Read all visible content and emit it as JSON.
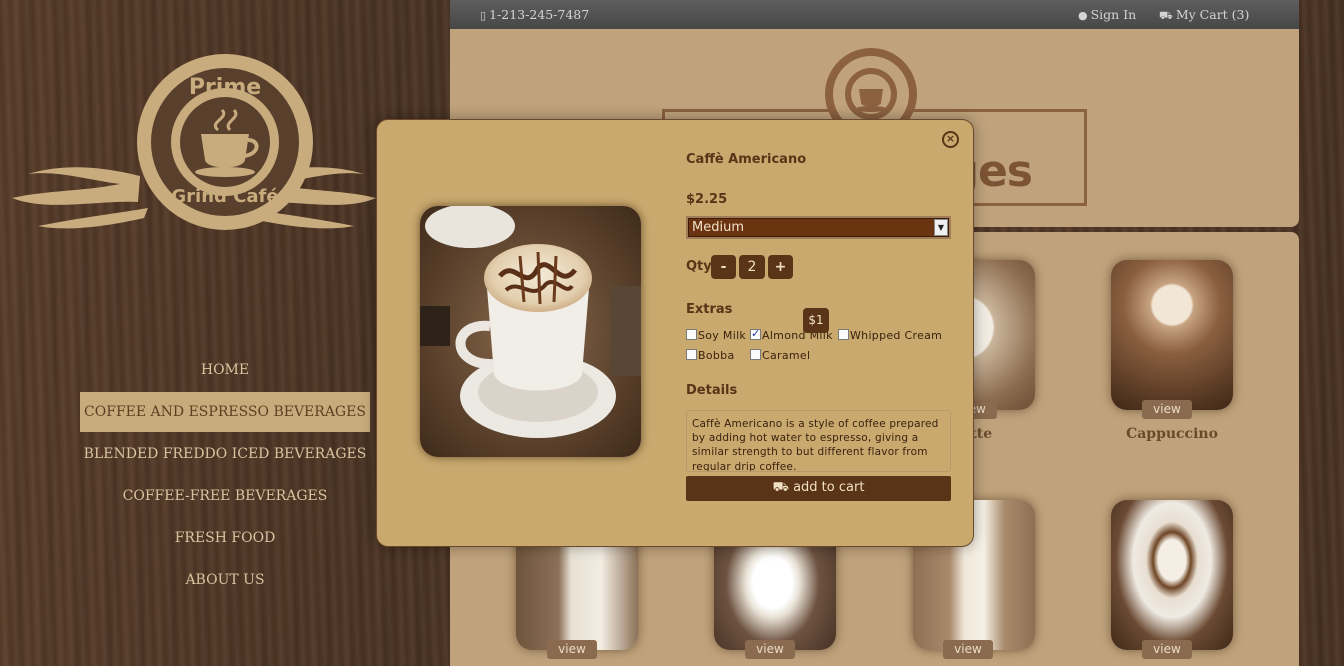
{
  "brand": {
    "logo_top": "Prime",
    "logo_bottom": "Grind Café"
  },
  "nav": {
    "items": [
      {
        "label": "HOME"
      },
      {
        "label": "COFFEE AND ESPRESSO BEVERAGES"
      },
      {
        "label": "BLENDED FREDDO ICED BEVERAGES"
      },
      {
        "label": "COFFEE-FREE BEVERAGES"
      },
      {
        "label": "FRESH FOOD"
      },
      {
        "label": "ABOUT US"
      }
    ],
    "active_index": 1
  },
  "topbar": {
    "phone": "1-213-245-7487",
    "sign_in": "Sign In",
    "cart": "My Cart (3)"
  },
  "header": {
    "heading_visible_part": "ges"
  },
  "products": {
    "visible_names": [
      "latte",
      "Cappuccino"
    ],
    "view_label": "view"
  },
  "modal": {
    "title": "Caffè Americano",
    "price": "$2.25",
    "size_selected": "Medium",
    "qty_label": "Qty",
    "qty_minus": "-",
    "qty_value": "2",
    "qty_plus": "+",
    "extras_label": "Extras",
    "extras": [
      {
        "label": "Soy Milk",
        "checked": false
      },
      {
        "label": "Almond Milk",
        "checked": true
      },
      {
        "label": "Whipped Cream",
        "checked": false
      },
      {
        "label": "Bobba",
        "checked": false
      },
      {
        "label": "Caramel",
        "checked": false
      }
    ],
    "extra_price_tip": "$1",
    "details_label": "Details",
    "description": "Caffè Americano is a style of coffee prepared by adding hot water to espresso, giving a similar strength to but different flavor from regular drip coffee.",
    "add_to_cart": "add to cart",
    "close_symbol": "×"
  },
  "colors": {
    "accent": "#5a3416",
    "panel": "#c0a37c",
    "modal_bg": "#c9a96e"
  }
}
